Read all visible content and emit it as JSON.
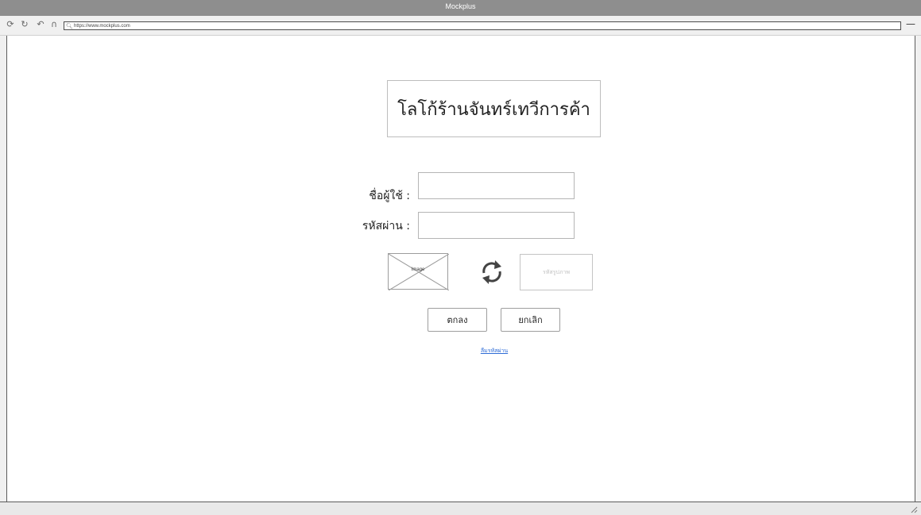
{
  "window": {
    "title": "Mockplus",
    "address_url": "https://www.mockplus.com"
  },
  "toolbar": {
    "icons": [
      "refresh-icon",
      "forward-icon",
      "back-icon",
      "home-icon"
    ]
  },
  "login": {
    "logo_text": "โลโก้ร้านจันทร์เทวีการค้า",
    "username_label": "ชื่อผู้ใช้ :",
    "password_label": "รหัสผ่าน :",
    "captcha_image_label": "Image",
    "captcha_placeholder": "รหัสรูปภาพ",
    "ok_label": "ตกลง",
    "cancel_label": "ยกเลิก",
    "forgot_link": "ลืมรหัสผ่าน"
  },
  "colors": {
    "titlebar": "#8e8e8e",
    "link": "#2d6bd6",
    "border": "#b5b5b5"
  }
}
